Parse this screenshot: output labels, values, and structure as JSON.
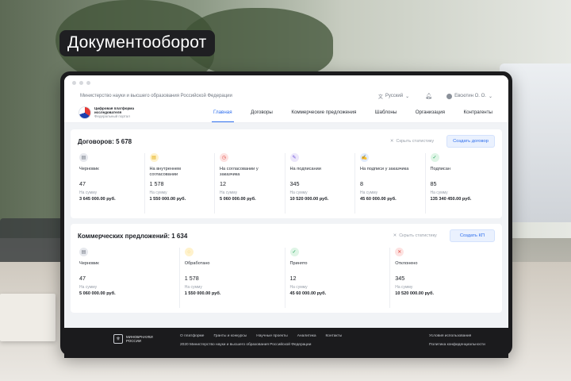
{
  "headline": "Документооборот",
  "topbar": {
    "ministry": "Министерство науки и высшего образования Российской Федерации",
    "language": "Русский",
    "user": "Евсютин О. О."
  },
  "logo": {
    "line1": "Цифровая платформа",
    "line2": "исследователя",
    "line3": "Федеральный портал"
  },
  "nav": {
    "items": [
      "Главная",
      "Договоры",
      "Коммерческие предложения",
      "Шаблоны",
      "Организация",
      "Контрагенты"
    ],
    "active": "Главная"
  },
  "contracts": {
    "title": "Договоров: 5 678",
    "hide_stats": "Скрыть статистику",
    "button": "Создать договор",
    "sum_label": "На сумму",
    "cards": [
      {
        "label": "Черновик",
        "count": "47",
        "sum": "3 645 000.00 руб.",
        "icon": "document-icon",
        "color": "gray"
      },
      {
        "label": "На внутреннем согласовании",
        "count": "1 578",
        "sum": "1 550 000.00 руб.",
        "icon": "document-pending-icon",
        "color": "yellow"
      },
      {
        "label": "На согласовании у заказчика",
        "count": "12",
        "sum": "5 060 000.00 руб.",
        "icon": "clock-icon",
        "color": "red"
      },
      {
        "label": "На подписании",
        "count": "345",
        "sum": "10 520 000.00 руб.",
        "icon": "signature-icon",
        "color": "purple"
      },
      {
        "label": "На подписи у заказчика",
        "count": "8",
        "sum": "45 60 000.00 руб.",
        "icon": "document-sign-icon",
        "color": "blue"
      },
      {
        "label": "Подписан",
        "count": "85",
        "sum": "135 340 450.00 руб.",
        "icon": "document-check-icon",
        "color": "green"
      }
    ]
  },
  "proposals": {
    "title": "Коммерческих предложений: 1 634",
    "hide_stats": "Скрыть статистику",
    "button": "Создать КП",
    "sum_label": "На сумму",
    "cards": [
      {
        "label": "Черновик",
        "count": "47",
        "sum": "5 060 000.00 руб.",
        "icon": "document-icon",
        "color": "gray"
      },
      {
        "label": "Обработано",
        "count": "1 578",
        "sum": "1 550 000.00 руб.",
        "icon": "processing-icon",
        "color": "yellow"
      },
      {
        "label": "Принято",
        "count": "12",
        "sum": "45 60 000.00 руб.",
        "icon": "check-icon",
        "color": "green"
      },
      {
        "label": "Отклонено",
        "count": "345",
        "sum": "10 520 000.00 руб.",
        "icon": "reject-icon",
        "color": "red"
      }
    ]
  },
  "footer": {
    "logo_line1": "МИНОБРНАУКИ",
    "logo_line2": "РОССИИ",
    "links": [
      "О платформе",
      "Гранты и конкурсы",
      "Научные проекты",
      "Аналитика",
      "Контакты"
    ],
    "copyright": "2020 Министерство науки и высшего образования Российской Федерации",
    "terms": "Условия использования",
    "privacy": "Политика конфиденциальности"
  }
}
